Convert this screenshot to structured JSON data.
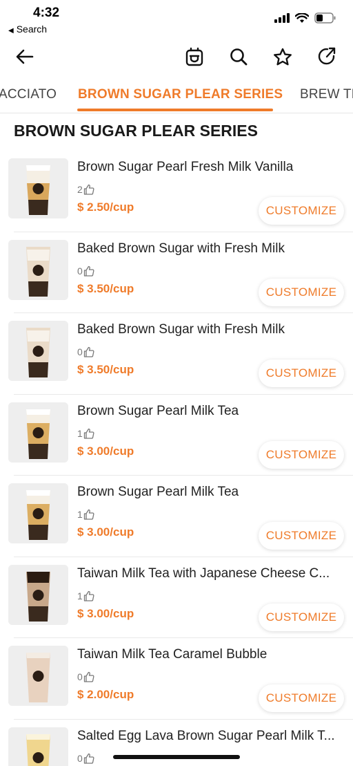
{
  "status_bar": {
    "time": "4:32",
    "back_label": "Search"
  },
  "nav": {
    "icons": [
      "back-arrow-icon",
      "bag-icon",
      "search-icon",
      "star-icon",
      "share-icon"
    ]
  },
  "tabs": [
    {
      "label": "ACCIATO",
      "active": false
    },
    {
      "label": "BROWN SUGAR PLEAR SERIES",
      "active": true
    },
    {
      "label": "BREW TE",
      "active": false
    }
  ],
  "section_title": "BROWN SUGAR PLEAR SERIES",
  "products": [
    {
      "name": "Brown Sugar Pearl Fresh Milk Vanilla",
      "likes": "2",
      "price": "$ 2.50/cup",
      "button": "CUSTOMIZE"
    },
    {
      "name": "Baked Brown Sugar with Fresh Milk",
      "likes": "0",
      "price": "$ 3.50/cup",
      "button": "CUSTOMIZE"
    },
    {
      "name": "Baked Brown Sugar with Fresh Milk",
      "likes": "0",
      "price": "$ 3.50/cup",
      "button": "CUSTOMIZE"
    },
    {
      "name": "Brown Sugar Pearl Milk Tea",
      "likes": "1",
      "price": "$ 3.00/cup",
      "button": "CUSTOMIZE"
    },
    {
      "name": "Brown Sugar Pearl Milk Tea",
      "likes": "1",
      "price": "$ 3.00/cup",
      "button": "CUSTOMIZE"
    },
    {
      "name": "Taiwan Milk Tea with Japanese Cheese C...",
      "likes": "1",
      "price": "$ 3.00/cup",
      "button": "CUSTOMIZE"
    },
    {
      "name": "Taiwan Milk Tea Caramel Bubble",
      "likes": "0",
      "price": "$ 2.00/cup",
      "button": "CUSTOMIZE"
    },
    {
      "name": "Salted Egg Lava Brown Sugar Pearl Milk T...",
      "likes": "0",
      "price": "",
      "button": ""
    }
  ],
  "colors": {
    "accent": "#ef7b2a"
  }
}
